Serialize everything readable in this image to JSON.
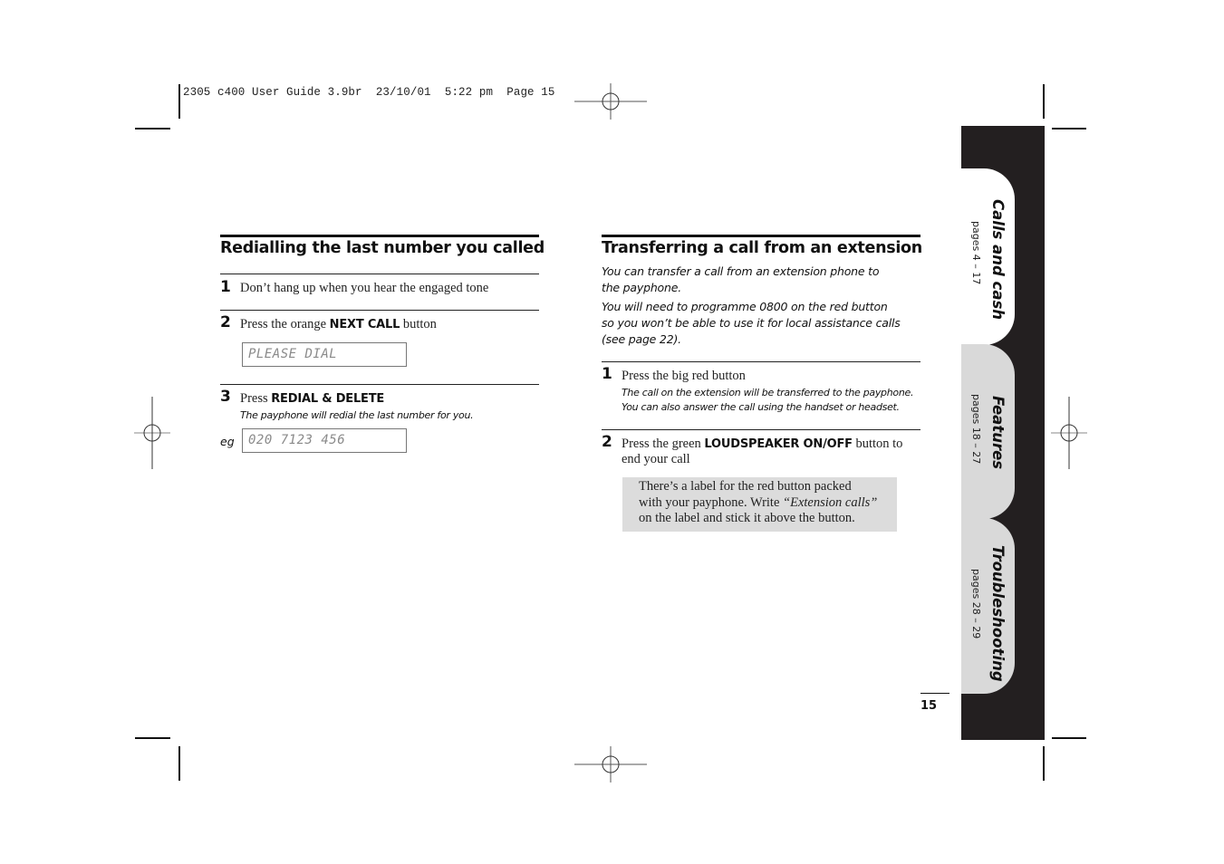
{
  "slug": "2305 c400 User Guide 3.9br  23/10/01  5:22 pm  Page 15",
  "left_section": {
    "title": "Redialling the last number you called",
    "steps": [
      {
        "num": "1",
        "text": "Don’t hang up when you hear the engaged tone"
      },
      {
        "num": "2",
        "text_before": "Press the orange ",
        "key": "NEXT CALL",
        "text_after": " button",
        "display": "PLEASE DIAL"
      },
      {
        "num": "3",
        "text_before": "Press ",
        "key": "REDIAL & DELETE",
        "note": "The payphone will redial the last number for you.",
        "example_label": "eg",
        "display": "020 7123 456"
      }
    ]
  },
  "right_section": {
    "title": "Transferring a call from an extension",
    "intro": [
      "You can transfer a call from an extension phone to the payphone.",
      "You will need to programme 0800 on the red button so you won’t be able to use it for local assistance calls (see page 22)."
    ],
    "intro_lines": [
      "You can transfer a call from an extension phone to",
      "the payphone.",
      "You will need to programme 0800 on the red button",
      "so you won’t be able to use it for local assistance calls",
      "(see page 22)."
    ],
    "steps": [
      {
        "num": "1",
        "text": "Press the big red button",
        "note_lines": [
          "The call on the extension will be transferred to the payphone.",
          "You can also answer the call using the handset or headset."
        ]
      },
      {
        "num": "2",
        "text_before": "Press the green ",
        "key": "LOUDSPEAKER ON/OFF",
        "text_after": " button to",
        "text_line2": "end your call"
      }
    ],
    "tip": {
      "line1": "There’s a label for the red button packed",
      "line2_before": "with your payphone. Write ",
      "line2_emph": "“Extension calls”",
      "line3": "on the label and stick it above the button."
    }
  },
  "tabs": [
    {
      "title": "Calls and cash",
      "pages": "pages 4 – 17",
      "active": true
    },
    {
      "title": "Features",
      "pages": "pages 18 – 27",
      "active": false
    },
    {
      "title": "Troubleshooting",
      "pages": "pages 28 – 29",
      "active": false
    }
  ],
  "page_number": "15",
  "colors": {
    "tab_strip": "#231f20",
    "tab_active": "#ffffff",
    "tab_inactive": "#d9d9d9",
    "tip_background": "#dcdcdc",
    "lcd_text": "#8a8a8a"
  }
}
